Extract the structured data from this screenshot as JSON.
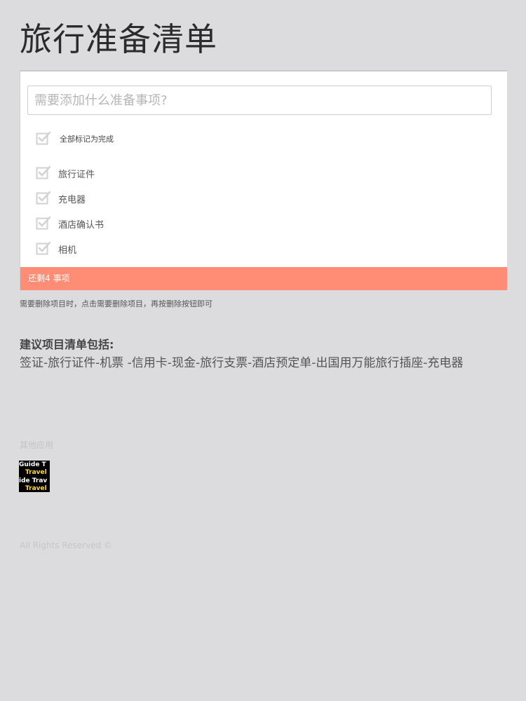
{
  "page": {
    "title": "旅行准备清单"
  },
  "todo": {
    "input_placeholder": "需要添加什么准备事项?",
    "toggle_all_label": "全部标记为完成",
    "items": [
      {
        "label": "旅行证件",
        "checked": false
      },
      {
        "label": "充电器",
        "checked": false
      },
      {
        "label": "酒店确认书",
        "checked": false
      },
      {
        "label": "相机",
        "checked": false
      }
    ],
    "remaining_text": "还剩4 事项"
  },
  "hint": "需要删除项目时，点击需要删除项目，再按删除按钮即可",
  "suggestions": {
    "heading": "建议项目清单包括:",
    "text": "签证-旅行证件-机票 -信用卡-现金-旅行支票-酒店预定单-出国用万能旅行插座-充电器"
  },
  "other_apps": {
    "heading": "其他应用",
    "app_thumb": {
      "line1": "Guide  T",
      "line2": "Travel",
      "line3": "ide Trav",
      "line4": "Travel"
    }
  },
  "copyright": "All Rights Reserved ©",
  "colors": {
    "background": "#dcdcde",
    "footer_bar": "#ff8c74",
    "check": "#d4d4d6"
  },
  "icons": {
    "checkbox": "checkbox-icon"
  }
}
